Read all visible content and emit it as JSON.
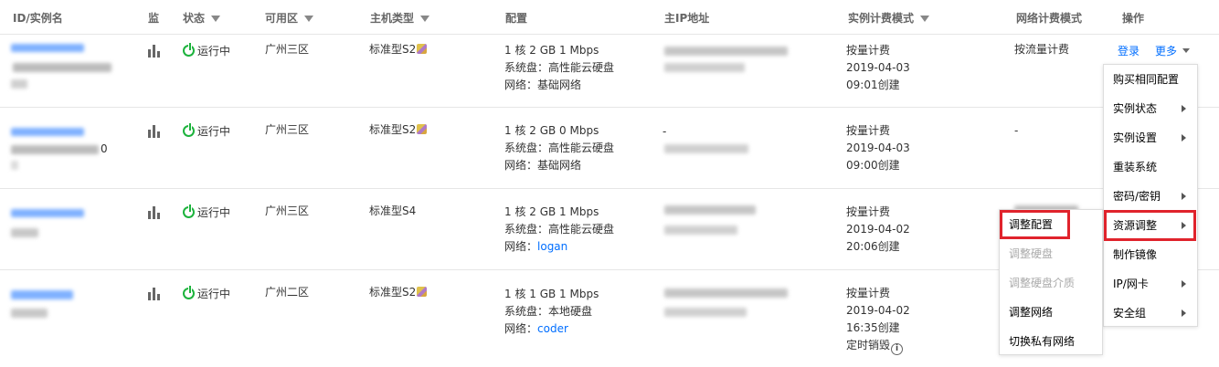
{
  "headers": {
    "id_name": "ID/实例名",
    "monitor": "监",
    "status": "状态",
    "zone": "可用区",
    "host_type": "主机类型",
    "config": "配置",
    "main_ip": "主IP地址",
    "billing_mode": "实例计费模式",
    "net_billing": "网络计费模式",
    "actions": "操作"
  },
  "rows": [
    {
      "status": "运行中",
      "zone": "广州三区",
      "host_type": "标准型S2",
      "config_line1": "1 核 2 GB 1 Mbps",
      "config_line2": "系统盘：高性能云硬盘",
      "config_net_label": "网络：",
      "config_net_value": "基础网络",
      "billing": "按量计费",
      "date": "2019-04-03",
      "created": "09:01创建",
      "net_billing": "按流量计费",
      "login": "登录",
      "more": "更多"
    },
    {
      "status": "运行中",
      "zone": "广州三区",
      "host_type": "标准型S2",
      "config_line1": "1 核 2 GB 0 Mbps",
      "config_line2": "系统盘：高性能云硬盘",
      "config_net_label": "网络：",
      "config_net_value": "基础网络",
      "ip_dash": "-",
      "name_tail": "0",
      "billing": "按量计费",
      "date": "2019-04-03",
      "created": "09:00创建",
      "net_billing": "-"
    },
    {
      "status": "运行中",
      "zone": "广州三区",
      "host_type": "标准型S4",
      "config_line1": "1 核 2 GB 1 Mbps",
      "config_line2": "系统盘：高性能云硬盘",
      "config_net_label": "网络：",
      "config_net_value": "logan",
      "billing": "按量计费",
      "date": "2019-04-02",
      "created": "20:06创建"
    },
    {
      "status": "运行中",
      "zone": "广州二区",
      "host_type": "标准型S2",
      "config_line1": "1 核 1 GB 1 Mbps",
      "config_line2": "系统盘：本地硬盘",
      "config_net_label": "网络：",
      "config_net_value": "coder",
      "billing": "按量计费",
      "date": "2019-04-02",
      "created": "16:35创建",
      "destroy": "定时销毁"
    }
  ],
  "more_menu": [
    {
      "label": "购买相同配置",
      "submenu": false
    },
    {
      "label": "实例状态",
      "submenu": true
    },
    {
      "label": "实例设置",
      "submenu": true
    },
    {
      "label": "重装系统",
      "submenu": false
    },
    {
      "label": "密码/密钥",
      "submenu": true
    },
    {
      "label": "资源调整",
      "submenu": true,
      "highlighted": true
    },
    {
      "label": "制作镜像",
      "submenu": false
    },
    {
      "label": "IP/网卡",
      "submenu": true
    },
    {
      "label": "安全组",
      "submenu": true
    }
  ],
  "resource_submenu": [
    {
      "label": "调整配置",
      "disabled": false,
      "highlighted": true
    },
    {
      "label": "调整硬盘",
      "disabled": true
    },
    {
      "label": "调整硬盘介质",
      "disabled": true
    },
    {
      "label": "调整网络",
      "disabled": false
    },
    {
      "label": "切换私有网络",
      "disabled": false
    }
  ],
  "colors": {
    "accent": "#006eff",
    "running": "#1db33d",
    "highlight": "#e0232c"
  }
}
